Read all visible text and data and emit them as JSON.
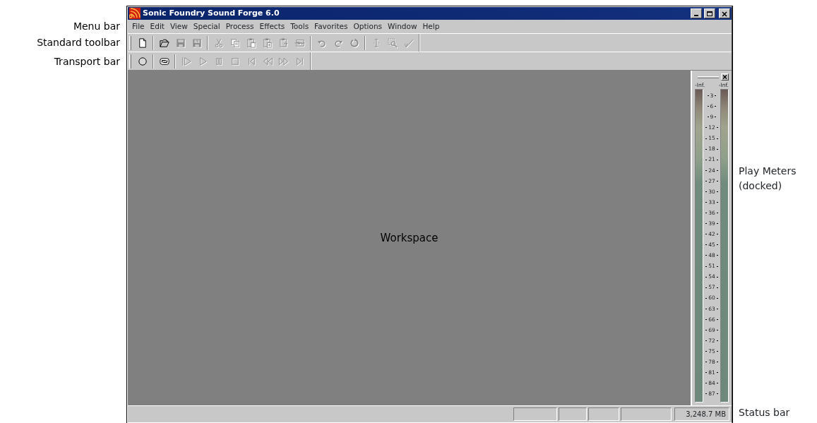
{
  "annotations": {
    "left": [
      "Menu bar",
      "Standard toolbar",
      "Transport bar"
    ],
    "meters": [
      "Play Meters",
      "(docked)"
    ],
    "status": "Status bar"
  },
  "window": {
    "title": "Sonic Foundry Sound Forge 6.0"
  },
  "menu": [
    {
      "label": "File"
    },
    {
      "label": "Edit"
    },
    {
      "label": "View"
    },
    {
      "label": "Special"
    },
    {
      "label": "Process"
    },
    {
      "label": "Effects"
    },
    {
      "label": "Tools"
    },
    {
      "label": "Favorites"
    },
    {
      "label": "Options"
    },
    {
      "label": "Window"
    },
    {
      "label": "Help"
    }
  ],
  "standard_toolbar": [
    {
      "kind": "button",
      "disabled": false
    },
    {
      "kind": "separator"
    },
    {
      "kind": "button",
      "disabled": false
    },
    {
      "kind": "button",
      "disabled": true
    },
    {
      "kind": "button",
      "disabled": true
    },
    {
      "kind": "separator"
    },
    {
      "kind": "button",
      "disabled": true
    },
    {
      "kind": "button",
      "disabled": true
    },
    {
      "kind": "button",
      "disabled": true
    },
    {
      "kind": "button",
      "disabled": true
    },
    {
      "kind": "button",
      "disabled": true
    },
    {
      "kind": "button",
      "disabled": true
    },
    {
      "kind": "separator"
    },
    {
      "kind": "button",
      "disabled": true
    },
    {
      "kind": "button",
      "disabled": true
    },
    {
      "kind": "button",
      "disabled": true
    },
    {
      "kind": "separator"
    },
    {
      "kind": "button",
      "disabled": true
    },
    {
      "kind": "button",
      "disabled": true
    },
    {
      "kind": "button",
      "disabled": true
    }
  ],
  "transport_toolbar": [
    {
      "kind": "button",
      "disabled": false
    },
    {
      "kind": "separator"
    },
    {
      "kind": "button",
      "disabled": false
    },
    {
      "kind": "separator"
    },
    {
      "kind": "button",
      "disabled": true
    },
    {
      "kind": "button",
      "disabled": true
    },
    {
      "kind": "button",
      "disabled": true
    },
    {
      "kind": "button",
      "disabled": true
    },
    {
      "kind": "button",
      "disabled": true
    },
    {
      "kind": "button",
      "disabled": true
    },
    {
      "kind": "button",
      "disabled": true
    },
    {
      "kind": "button",
      "disabled": true
    }
  ],
  "workspace": {
    "label": "Workspace"
  },
  "play_meters": {
    "channel_labels": [
      "-Inf.",
      "-Inf."
    ],
    "scale": [
      "3",
      "6",
      "9",
      "12",
      "15",
      "18",
      "21",
      "24",
      "27",
      "30",
      "33",
      "36",
      "39",
      "42",
      "45",
      "48",
      "51",
      "54",
      "57",
      "60",
      "63",
      "66",
      "69",
      "72",
      "75",
      "78",
      "81",
      "84",
      "87"
    ]
  },
  "status_bar": {
    "memory": "3,248.7 MB"
  }
}
